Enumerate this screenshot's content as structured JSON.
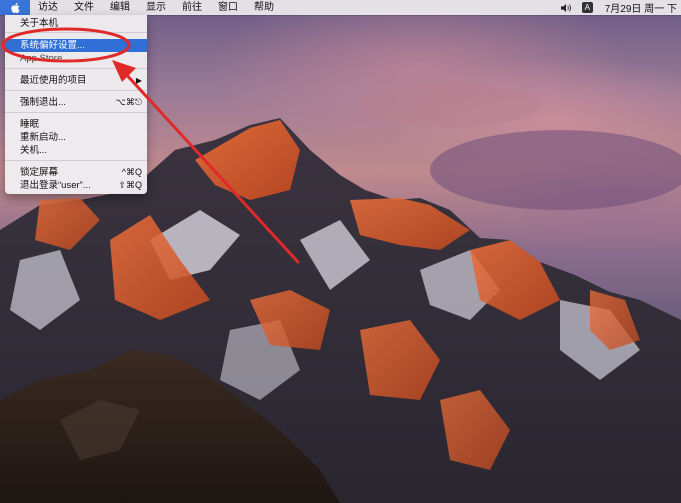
{
  "menubar": {
    "items": [
      {
        "label": "访达"
      },
      {
        "label": "文件"
      },
      {
        "label": "编辑"
      },
      {
        "label": "显示"
      },
      {
        "label": "前往"
      },
      {
        "label": "窗口"
      },
      {
        "label": "帮助"
      }
    ],
    "input_source": "A",
    "clock": "7月29日 周一 下",
    "icons": {
      "apple": "apple-icon",
      "volume": "speaker-icon"
    }
  },
  "apple_menu": {
    "items": [
      {
        "label": "关于本机",
        "shortcut": ""
      },
      {
        "label": "系统偏好设置...",
        "shortcut": "",
        "highlighted": true
      },
      {
        "label": "App Store...",
        "shortcut": ""
      },
      {
        "label": "最近使用的项目",
        "shortcut": "",
        "submenu": true
      },
      {
        "label": "强制退出...",
        "shortcut": "⌥⌘⎋"
      },
      {
        "label": "睡眠",
        "shortcut": ""
      },
      {
        "label": "重新启动...",
        "shortcut": ""
      },
      {
        "label": "关机...",
        "shortcut": ""
      },
      {
        "label": "锁定屏幕",
        "shortcut": "^⌘Q"
      },
      {
        "label": "退出登录“user”...",
        "shortcut": "⇧⌘Q"
      }
    ]
  },
  "colors": {
    "highlight": "#2f6fd6",
    "annotation": "#e02a2a",
    "menubar": "#eeecee"
  }
}
